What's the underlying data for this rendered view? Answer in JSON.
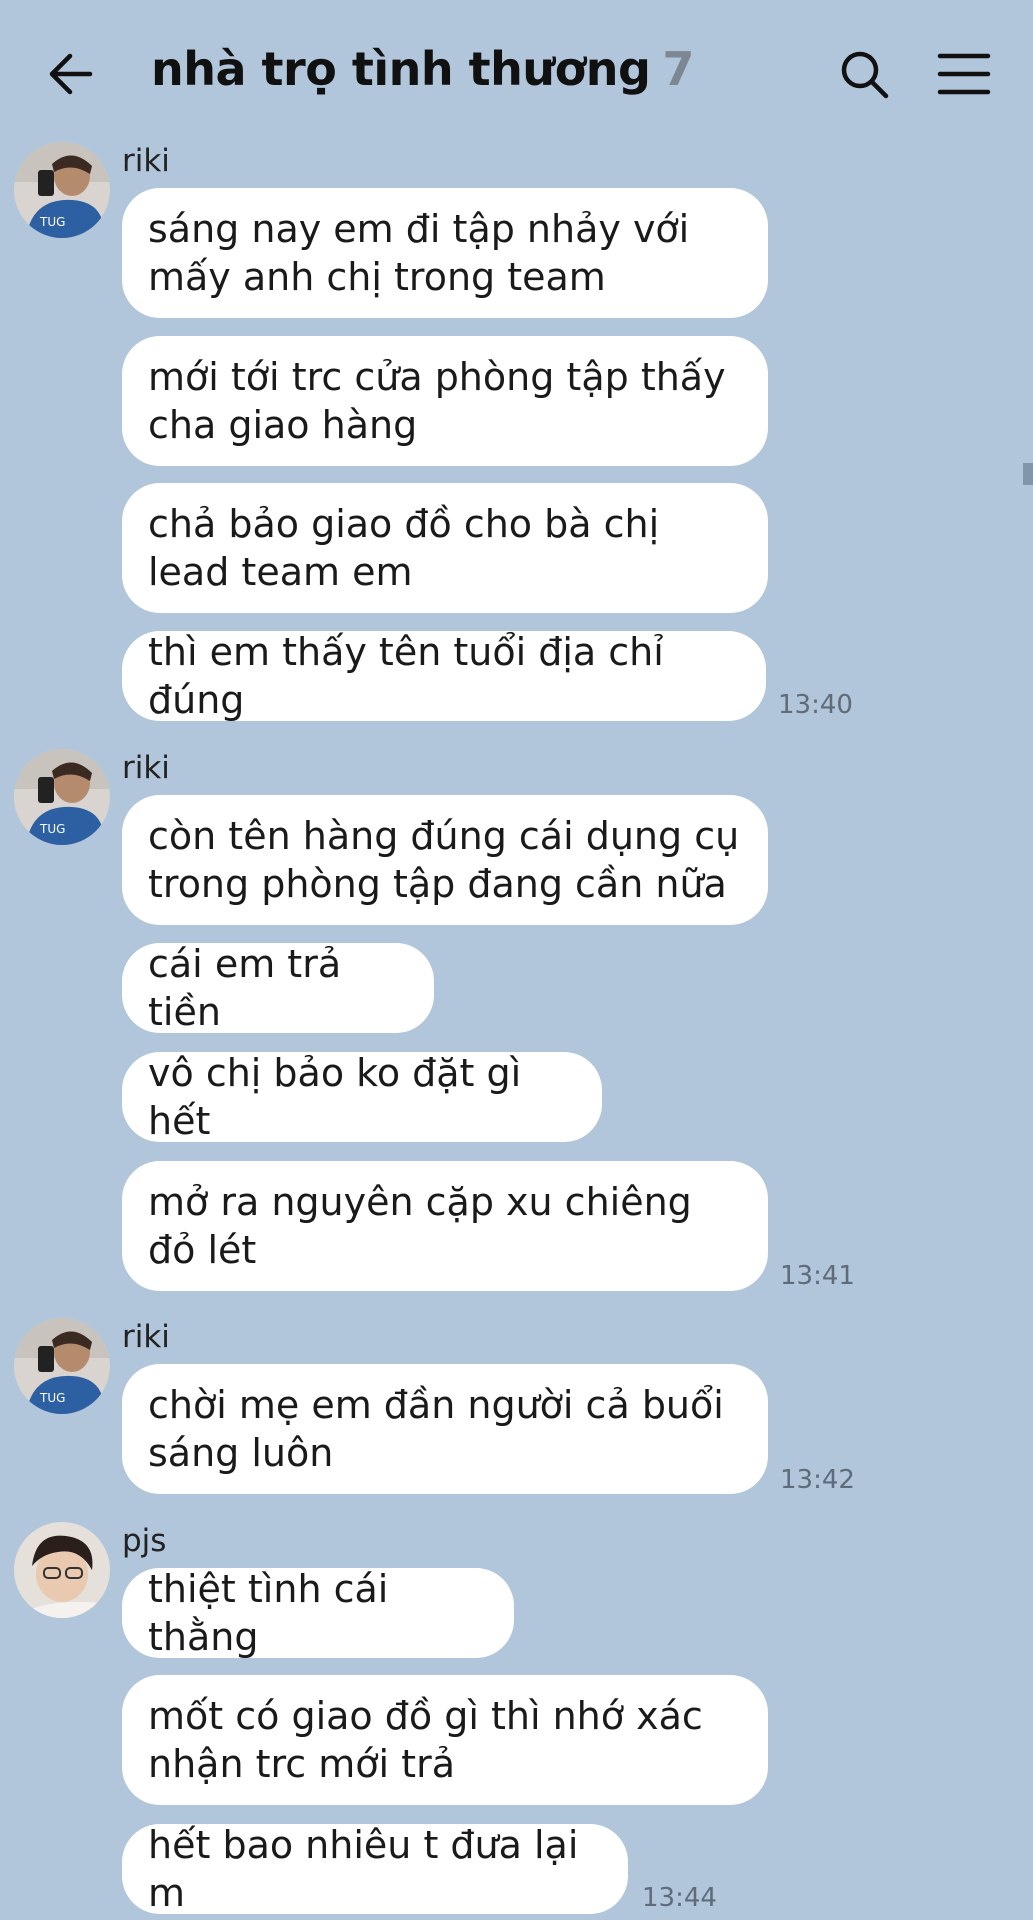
{
  "header": {
    "title": "nhà trọ tình thương",
    "member_count": "7"
  },
  "messages": [
    {
      "sender": "riki",
      "bubbles": [
        "sáng nay em đi tập nhảy với mấy anh chị trong team",
        "mới tới trc cửa phòng tập thấy cha giao hàng",
        "chả bảo giao đồ cho bà chị lead team em",
        "thì em thấy tên tuổi địa chỉ đúng"
      ],
      "time": "13:40"
    },
    {
      "sender": "riki",
      "bubbles": [
        "còn tên hàng đúng cái dụng cụ trong phòng tập đang cần nữa",
        "cái em trả tiền",
        "vô chị bảo ko đặt gì hết",
        "mở ra nguyên cặp xu chiêng đỏ lét"
      ],
      "time": "13:41"
    },
    {
      "sender": "riki",
      "bubbles": [
        "chời mẹ em đần người cả buổi sáng luôn"
      ],
      "time": "13:42"
    },
    {
      "sender": "pjs",
      "bubbles": [
        "thiệt tình cái thằng",
        "mốt có giao đồ gì thì nhớ xác nhận trc mới trả",
        "hết bao nhiêu t đưa lại m"
      ],
      "time": "13:44"
    }
  ],
  "colors": {
    "background": "#b1c6db",
    "bubble": "#ffffff",
    "timestamp": "#5f6b78"
  }
}
